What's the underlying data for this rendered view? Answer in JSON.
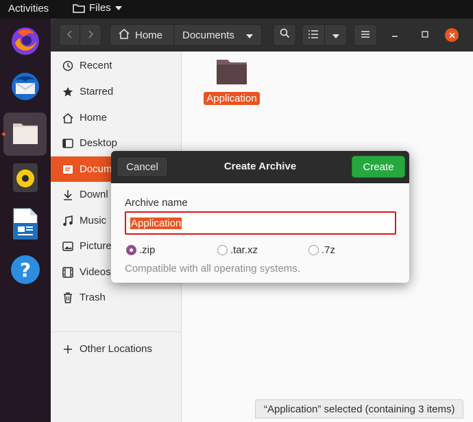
{
  "topbar": {
    "activities": "Activities",
    "app_menu": "Files"
  },
  "dock": {
    "items": [
      "firefox-icon",
      "thunderbird-icon",
      "files-icon",
      "rhythmbox-icon",
      "libreoffice-writer-icon",
      "help-icon"
    ],
    "active": "files-icon"
  },
  "header": {
    "breadcrumb": [
      "Home",
      "Documents"
    ]
  },
  "sidebar": {
    "items": [
      {
        "label": "Recent",
        "icon": "clock-icon"
      },
      {
        "label": "Starred",
        "icon": "star-icon"
      },
      {
        "label": "Home",
        "icon": "home-icon"
      },
      {
        "label": "Desktop",
        "icon": "desktop-icon"
      },
      {
        "label": "Docum",
        "icon": "document-icon",
        "selected": true
      },
      {
        "label": "Downl",
        "icon": "download-icon"
      },
      {
        "label": "Music",
        "icon": "music-icon"
      },
      {
        "label": "Picture",
        "icon": "picture-icon"
      },
      {
        "label": "Videos",
        "icon": "video-icon"
      },
      {
        "label": "Trash",
        "icon": "trash-icon"
      }
    ],
    "other": {
      "label": "Other Locations",
      "icon": "plus-icon"
    }
  },
  "content": {
    "folder_label": "Application",
    "status": "“Application” selected  (containing 3 items)"
  },
  "dialog": {
    "title": "Create Archive",
    "cancel": "Cancel",
    "create": "Create",
    "field_label": "Archive name",
    "name_value": "Application",
    "formats": [
      ".zip",
      ".tar.xz",
      ".7z"
    ],
    "selected_format": ".zip",
    "hint": "Compatible with all operating systems."
  },
  "colors": {
    "accent": "#e95420",
    "create": "#26a83f",
    "radio": "#924d8b",
    "highlight_border": "#e0141b"
  }
}
